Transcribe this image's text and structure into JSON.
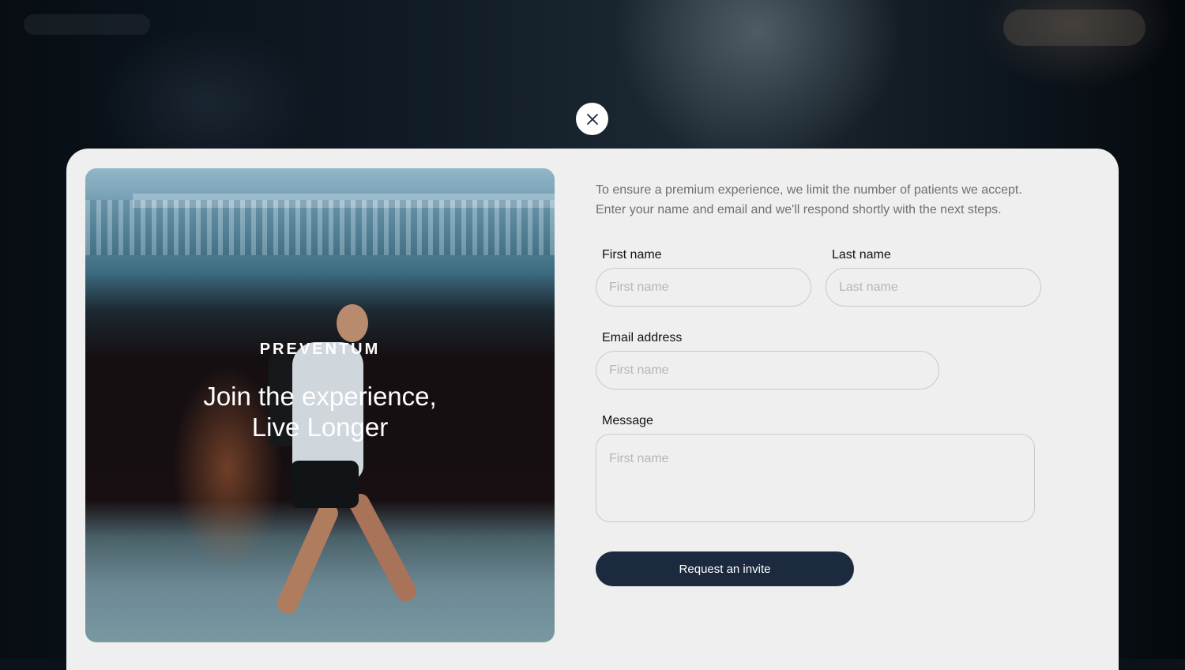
{
  "modal": {
    "close_icon": "close-icon",
    "hero": {
      "brand": "PREVENTUM",
      "headline_line1": "Join the experience,",
      "headline_line2": "Live Longer"
    },
    "intro_line1": "To ensure a premium experience, we limit the number of patients we accept.",
    "intro_line2": "Enter your name and email and we'll respond shortly with the next steps.",
    "form": {
      "first_name": {
        "label": "First name",
        "placeholder": "First name",
        "value": ""
      },
      "last_name": {
        "label": "Last name",
        "placeholder": "Last name",
        "value": ""
      },
      "email": {
        "label": "Email address",
        "placeholder": "First name",
        "value": ""
      },
      "message": {
        "label": "Message",
        "placeholder": "First name",
        "value": ""
      },
      "submit_label": "Request an invite"
    }
  },
  "colors": {
    "modal_bg": "#efefef",
    "button_bg": "#1c2a40",
    "button_text": "#ffffff"
  }
}
